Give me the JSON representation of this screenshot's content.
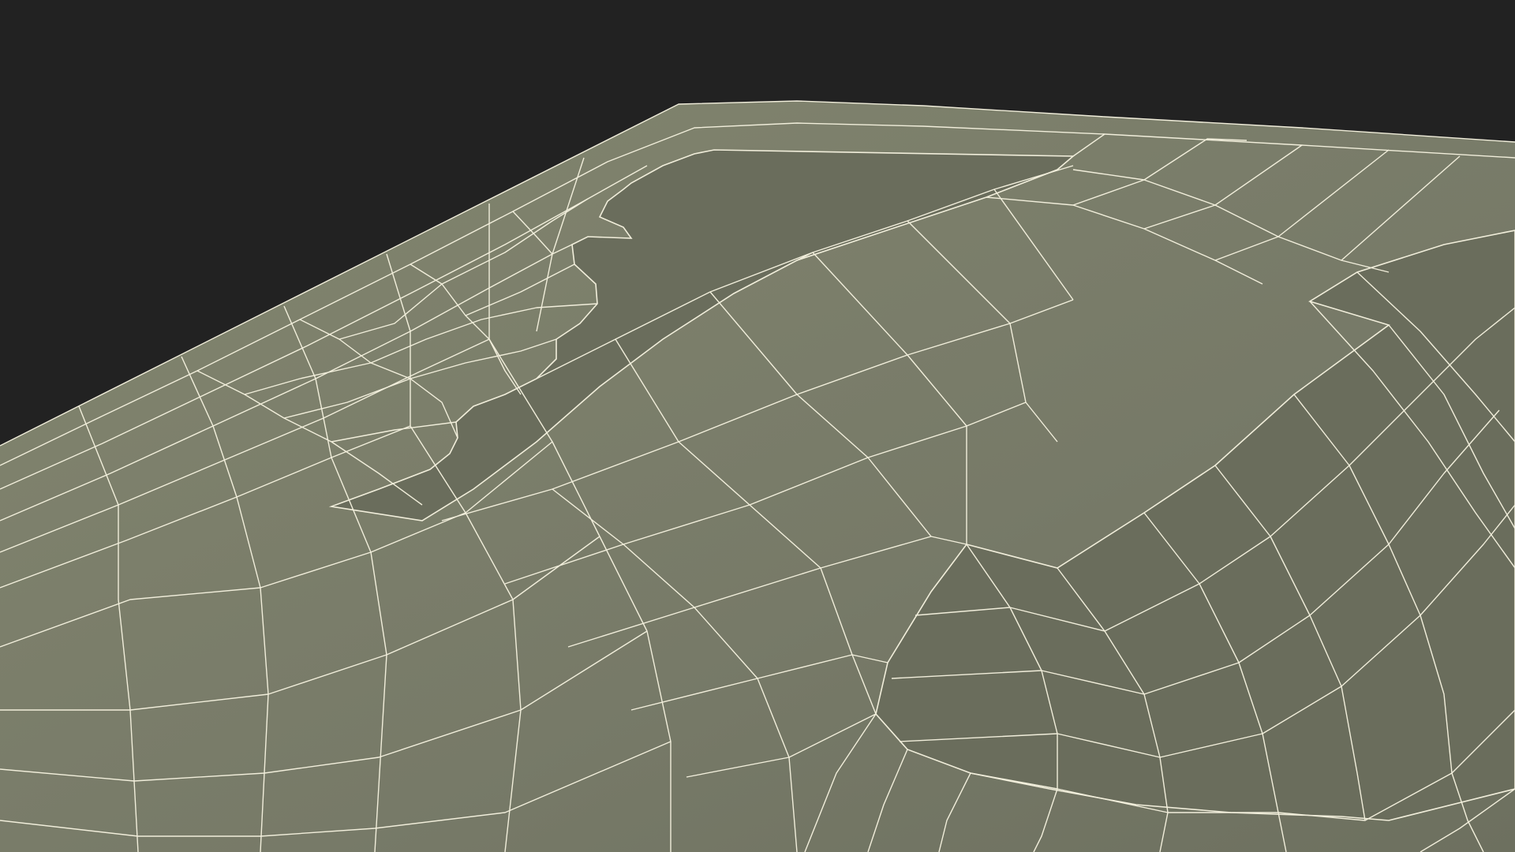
{
  "scene": {
    "subject": "wireframe-mesh-render",
    "colors": {
      "background": "#222222",
      "surface": "#777a68",
      "surface_shade": "#6c6f5e",
      "recess": "#6a6d5c",
      "wire": "#f1eedb"
    }
  }
}
